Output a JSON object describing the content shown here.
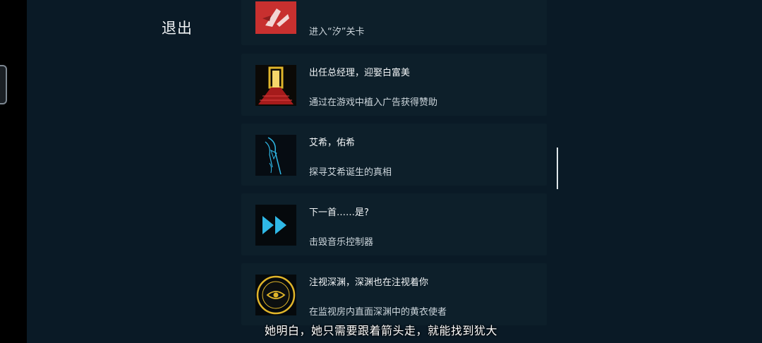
{
  "exit_label": "退出",
  "achievements": [
    {
      "icon": "red-mark-icon",
      "title": "",
      "desc": "进入“汐”关卡"
    },
    {
      "icon": "golden-door-icon",
      "title": "出任总经理，迎娶白富美",
      "desc": "通过在游戏中植入广告获得赞助"
    },
    {
      "icon": "scythe-figure-icon",
      "title": "艾希，佑希",
      "desc": "探寻艾希诞生的真相"
    },
    {
      "icon": "fast-forward-icon",
      "title": "下一首……是?",
      "desc": "击毁音乐控制器"
    },
    {
      "icon": "eye-emblem-icon",
      "title": "注视深渊，深渊也在注视着你",
      "desc": "在监视房内直面深渊中的黄衣使者"
    }
  ],
  "subtitle": "她明白，她只需要跟着箭头走，就能找到犹大",
  "colors": {
    "background": "#0a1a26",
    "card": "#0d1f2a",
    "accent_cyan": "#2fb8e6",
    "accent_gold": "#e0b52a",
    "accent_red": "#c8302f"
  }
}
